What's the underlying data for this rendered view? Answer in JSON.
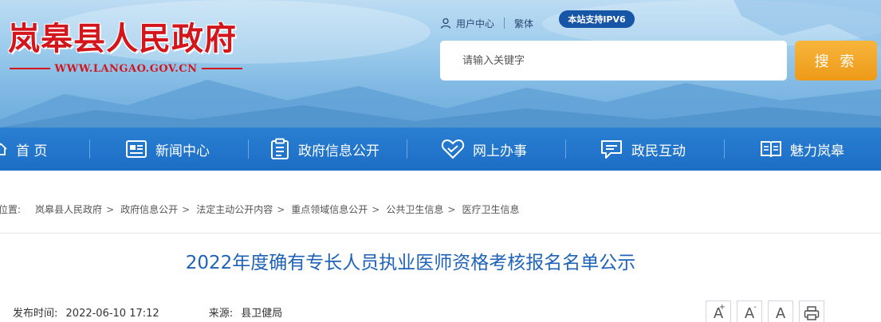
{
  "header": {
    "site_name": "岚皋县人民政府",
    "site_url": "WWW.LANGAO.GOV.CN",
    "user_center": "用户中心",
    "traditional": "繁体",
    "ipv6_badge": "本站支持IPV6",
    "search_placeholder": "请输入关键字",
    "search_button": "搜 索"
  },
  "nav": {
    "items": [
      {
        "label": "首 页",
        "icon": "home-icon"
      },
      {
        "label": "新闻中心",
        "icon": "news-icon"
      },
      {
        "label": "政府信息公开",
        "icon": "clipboard-icon"
      },
      {
        "label": "网上办事",
        "icon": "heart-hand-icon"
      },
      {
        "label": "政民互动",
        "icon": "chat-icon"
      },
      {
        "label": "魅力岚皋",
        "icon": "book-icon"
      }
    ]
  },
  "breadcrumb": {
    "prefix": "位置:",
    "items": [
      "岚皋县人民政府",
      "政府信息公开",
      "法定主动公开内容",
      "重点领域信息公开",
      "公共卫生信息",
      "医疗卫生信息"
    ],
    "separator": ">"
  },
  "article": {
    "title": "2022年度确有专长人员执业医师资格考核报名名单公示",
    "publish_label": "发布时间:",
    "publish_time": "2022-06-10 17:12",
    "source_label": "来源:",
    "source": "县卫健局"
  },
  "tools": {
    "font_increase": "A",
    "font_decrease": "A",
    "font_reset": "A",
    "plus_sign": "+",
    "minus_sign": "-"
  },
  "colors": {
    "brand_red": "#d2161c",
    "nav_blue": "#1c6ec5",
    "title_blue": "#1f63b9",
    "search_orange": "#ee9a18",
    "ipv6_blue": "#1756a7"
  }
}
